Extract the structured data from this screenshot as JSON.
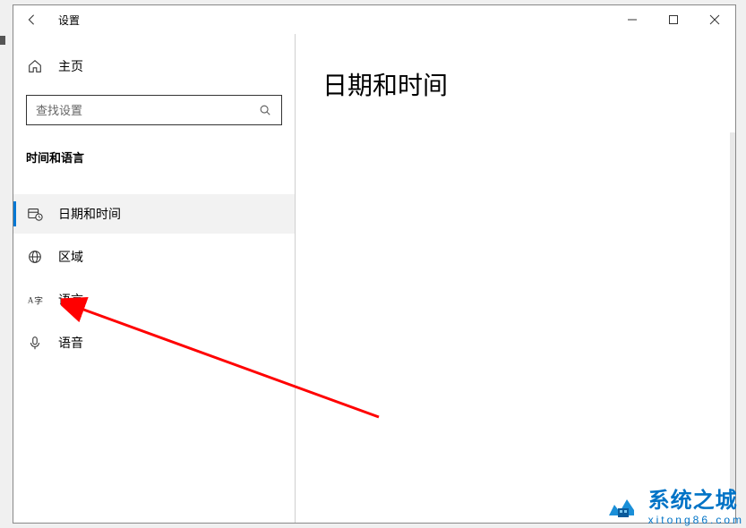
{
  "window": {
    "title": "设置"
  },
  "sidebar": {
    "home_label": "主页",
    "search_placeholder": "查找设置",
    "section_label": "时间和语言",
    "items": [
      {
        "label": "日期和时间",
        "icon": "calendar-clock-icon",
        "selected": true
      },
      {
        "label": "区域",
        "icon": "globe-icon",
        "selected": false
      },
      {
        "label": "语言",
        "icon": "language-icon",
        "selected": false
      },
      {
        "label": "语音",
        "icon": "microphone-icon",
        "selected": false
      }
    ]
  },
  "main": {
    "page_title": "日期和时间"
  },
  "watermark": {
    "title": "系统之城",
    "url": "xitong86.com"
  },
  "colors": {
    "accent": "#0078d4",
    "arrow": "#ff0000",
    "watermark": "#0073c6"
  }
}
